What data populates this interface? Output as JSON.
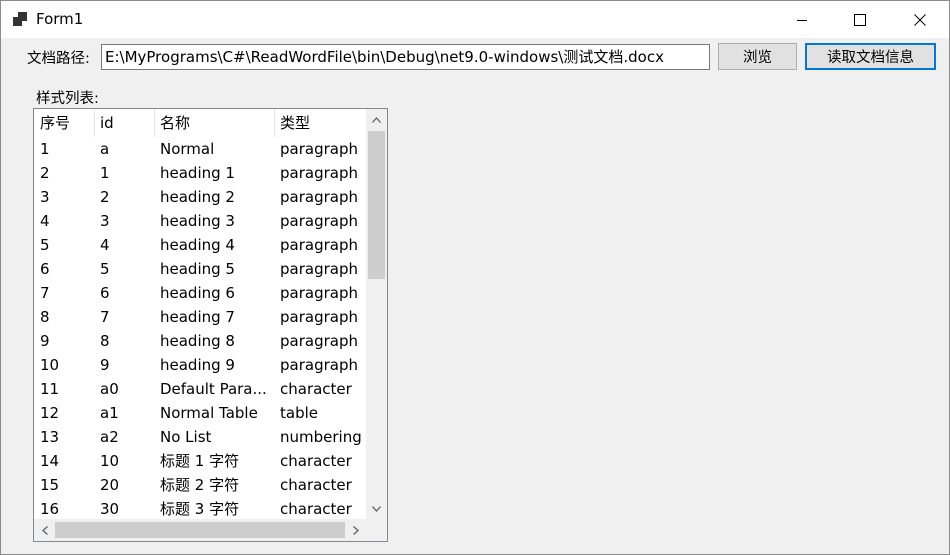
{
  "window": {
    "title": "Form1",
    "app_icon": "winforms-form-icon",
    "controls": [
      "minimize-icon",
      "maximize-icon",
      "close-icon"
    ]
  },
  "path": {
    "label": "文档路径:",
    "value": "E:\\MyPrograms\\C#\\ReadWordFile\\bin\\Debug\\net9.0-windows\\测试文档.docx"
  },
  "buttons": {
    "browse": "浏览",
    "read": "读取文档信息",
    "read_border_color": "#0078d7"
  },
  "styles": {
    "label": "样式列表:",
    "columns": [
      "序号",
      "id",
      "名称",
      "类型"
    ],
    "rows": [
      [
        "1",
        "a",
        "Normal",
        "paragraph"
      ],
      [
        "2",
        "1",
        "heading 1",
        "paragraph"
      ],
      [
        "3",
        "2",
        "heading 2",
        "paragraph"
      ],
      [
        "4",
        "3",
        "heading 3",
        "paragraph"
      ],
      [
        "5",
        "4",
        "heading 4",
        "paragraph"
      ],
      [
        "6",
        "5",
        "heading 5",
        "paragraph"
      ],
      [
        "7",
        "6",
        "heading 6",
        "paragraph"
      ],
      [
        "8",
        "7",
        "heading 7",
        "paragraph"
      ],
      [
        "9",
        "8",
        "heading 8",
        "paragraph"
      ],
      [
        "10",
        "9",
        "heading 9",
        "paragraph"
      ],
      [
        "11",
        "a0",
        "Default Para...",
        "character"
      ],
      [
        "12",
        "a1",
        "Normal Table",
        "table"
      ],
      [
        "13",
        "a2",
        "No List",
        "numbering"
      ],
      [
        "14",
        "10",
        "标题 1 字符",
        "character"
      ],
      [
        "15",
        "20",
        "标题 2 字符",
        "character"
      ],
      [
        "16",
        "30",
        "标题 3 字符",
        "character"
      ]
    ]
  }
}
